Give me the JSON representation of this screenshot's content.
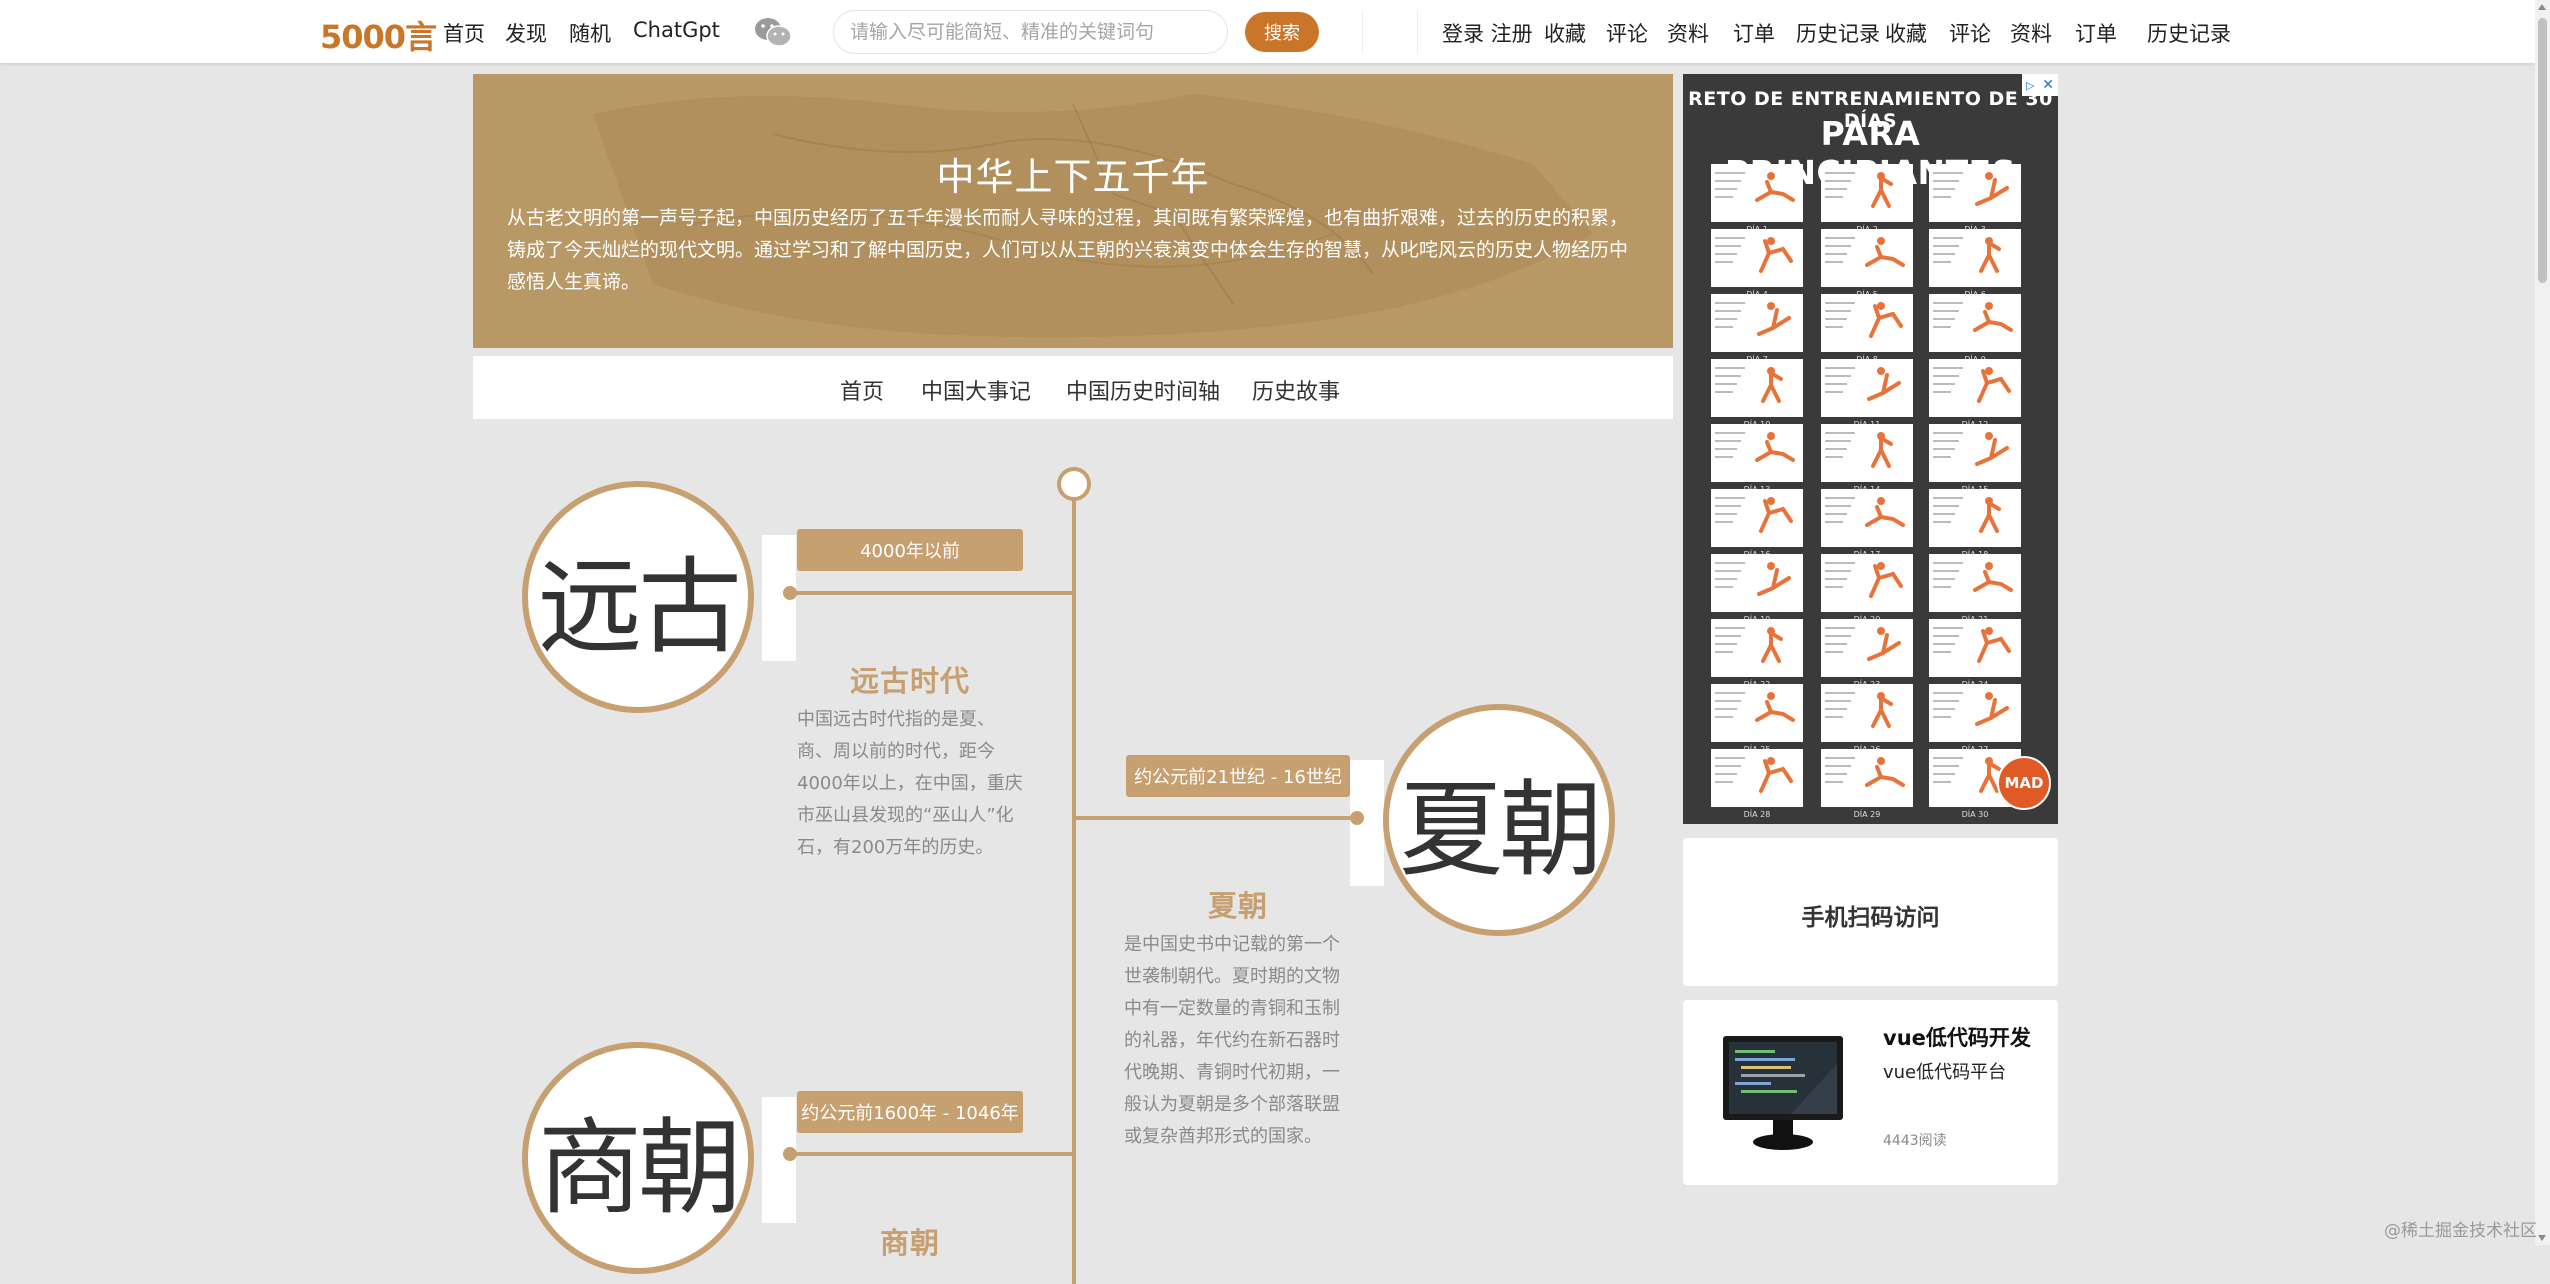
{
  "topnav": {
    "logo": "5000言",
    "links": [
      "首页",
      "发现",
      "随机",
      "ChatGpt"
    ],
    "search_placeholder": "请输入尽可能简短、精准的关键词句",
    "search_button": "搜索",
    "login_register": "登录 注册",
    "user_links": [
      "收藏",
      "评论",
      "资料",
      "订单",
      "历史记录",
      "收藏",
      "评论",
      "资料",
      "订单",
      "历史记录"
    ]
  },
  "banner": {
    "title": "中华上下五千年",
    "description": "从古老文明的第一声号子起，中国历史经历了五千年漫长而耐人寻味的过程，其间既有繁荣辉煌，也有曲折艰难，过去的历史的积累，铸成了今天灿烂的现代文明。通过学习和了解中国历史，人们可以从王朝的兴衰演变中体会生存的智慧，从叱咤风云的历史人物经历中感悟人生真谛。"
  },
  "subnav": [
    "首页",
    "中国大事记",
    "中国历史时间轴",
    "历史故事"
  ],
  "timeline": [
    {
      "circle_text": "远古",
      "date": "4000年以前",
      "title": "远古时代",
      "description": "中国远古时代指的是夏、商、周以前的时代，距今4000年以上，在中国，重庆市巫山县发现的“巫山人”化石，有200万年的历史。"
    },
    {
      "circle_text": "夏朝",
      "date": "约公元前21世纪 - 16世纪",
      "title": "夏朝",
      "description": "是中国史书中记载的第一个世袭制朝代。夏时期的文物中有一定数量的青铜和玉制的礼器，年代约在新石器时代晚期、青铜时代初期，一般认为夏朝是多个部落联盟或复杂酋邦形式的国家。"
    },
    {
      "circle_text": "商朝",
      "date": "约公元前1600年 - 1046年",
      "title": "商朝",
      "description": ""
    }
  ],
  "ad": {
    "heading_small": "RETO DE ENTRENAMIENTO DE 30 DÍAS",
    "heading_large": "PARA PRINCIPIANTES",
    "badge": "MAD",
    "day_labels": [
      "DÍA 1",
      "DÍA 2",
      "DÍA 3",
      "DÍA 4",
      "DÍA 5",
      "DÍA 6",
      "DÍA 7",
      "DÍA 8",
      "DÍA 9",
      "DÍA 10",
      "DÍA 11",
      "DÍA 12",
      "DÍA 13",
      "DÍA 14",
      "DÍA 15",
      "DÍA 16",
      "DÍA 17",
      "DÍA 18",
      "DÍA 19",
      "DÍA 20",
      "DÍA 21",
      "DÍA 22",
      "DÍA 23",
      "DÍA 24",
      "DÍA 25",
      "DÍA 26",
      "DÍA 27",
      "DÍA 28",
      "DÍA 29",
      "DÍA 30"
    ]
  },
  "qr_card": {
    "title": "手机扫码访问"
  },
  "blog_card": {
    "title": "vue低代码开发",
    "subtitle": "vue低代码平台",
    "views": "4443阅读"
  },
  "watermark": "@稀土掘金技术社区",
  "colors": {
    "accent": "#c6a070",
    "logo": "#c9762a",
    "search_button": "#c9762a",
    "banner": "#b89865"
  }
}
